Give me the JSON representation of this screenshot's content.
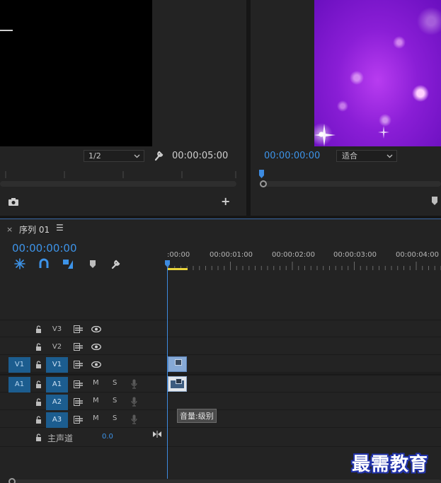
{
  "source_monitor": {
    "resolution": "1/2",
    "duration": "00:00:05:00"
  },
  "program_monitor": {
    "timecode": "00:00:00:00",
    "fit": "适合"
  },
  "timeline": {
    "sequence_name": "序列 01",
    "close_glyph": "×",
    "menu_glyph": "☰",
    "timecode": "00:00:00:00",
    "ruler_labels": [
      ":00:00",
      "00:00:01:00",
      "00:00:02:00",
      "00:00:03:00",
      "00:00:04:00"
    ],
    "video_tracks": [
      {
        "name": "V3",
        "source_patch": "",
        "targeted": false
      },
      {
        "name": "V2",
        "source_patch": "",
        "targeted": false
      },
      {
        "name": "V1",
        "source_patch": "V1",
        "targeted": true
      }
    ],
    "audio_tracks": [
      {
        "name": "A1",
        "source_patch": "A1",
        "targeted": true,
        "mute": "M",
        "solo": "S"
      },
      {
        "name": "A2",
        "source_patch": "",
        "targeted": true,
        "mute": "M",
        "solo": "S"
      },
      {
        "name": "A3",
        "source_patch": "",
        "targeted": true,
        "mute": "M",
        "solo": "S"
      }
    ],
    "master": {
      "label": "主声道",
      "value": "0.0"
    },
    "tooltip": "音量:级别",
    "accent_color": "#3d93e8",
    "work_area_color": "#e8d33a"
  },
  "watermark": "最需教育",
  "icons": [
    "camera-icon",
    "plus-icon",
    "wrench-icon",
    "marker-icon",
    "snap-icon",
    "magnet-link-icon",
    "add-marker-icon",
    "lock-icon",
    "sync-lock-icon",
    "eye-icon",
    "mic-icon"
  ]
}
